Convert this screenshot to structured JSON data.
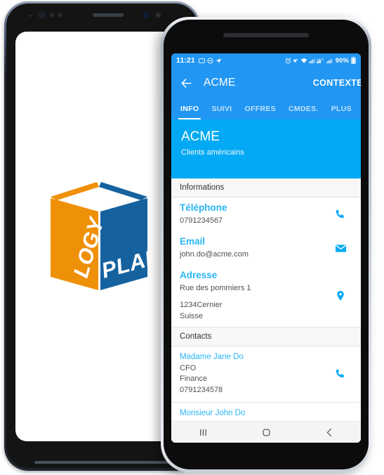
{
  "device_back": {
    "name": "back-phone-mockup"
  },
  "logo": {
    "left_face_text": "LOGY",
    "right_face_text": "PLAN",
    "orange": "#EF9009",
    "blue": "#15629F"
  },
  "status_bar": {
    "time": "11:21",
    "battery_percent": "90%",
    "icons_left": [
      "screencast-icon",
      "do-not-disturb-icon",
      "navigation-icon"
    ],
    "icons_right": [
      "alarm-icon",
      "mute-icon",
      "wifi-icon",
      "signal-icon",
      "lte-icon",
      "signal2-icon",
      "battery-icon"
    ]
  },
  "app_bar": {
    "back_icon": "back-arrow-icon",
    "title": "ACME",
    "action_label": "CONTEXTE"
  },
  "tabs": [
    {
      "label": "INFO",
      "active": true
    },
    {
      "label": "SUIVI",
      "active": false
    },
    {
      "label": "OFFRES",
      "active": false
    },
    {
      "label": "CMDES.",
      "active": false
    },
    {
      "label": "PLUS",
      "active": false
    }
  ],
  "hero": {
    "title": "ACME",
    "subtitle": "Clients américains",
    "background": "#03A9F4"
  },
  "sections": {
    "informations": {
      "header": "Informations",
      "fields": [
        {
          "label": "Téléphone",
          "value": "0791234567",
          "icon": "phone-icon"
        },
        {
          "label": "Email",
          "value": "john.do@acme.com",
          "icon": "envelope-icon"
        },
        {
          "label": "Adresse",
          "value_line1": "Rue des pommiers 1",
          "value_line2": "1234Cernier",
          "value_line3": "Suisse",
          "icon": "map-pin-icon"
        }
      ]
    },
    "contacts": {
      "header": "Contacts",
      "items": [
        {
          "name": "Madame Jane Do",
          "role": "CFO",
          "department": "Finance",
          "phone": "0791234578",
          "icon": "phone-icon"
        },
        {
          "name": "Monsieur John Do",
          "role": "",
          "department": "",
          "phone": "",
          "icon": "phone-icon"
        }
      ]
    }
  },
  "nav_bar": {
    "recents_label": "recents-icon",
    "home_label": "home-icon",
    "back_label": "back-icon"
  },
  "colors": {
    "app_bar": "#2196F3",
    "accent": "#03A9F4",
    "link": "#29B6F6",
    "section_bg": "#F7F7F7"
  }
}
